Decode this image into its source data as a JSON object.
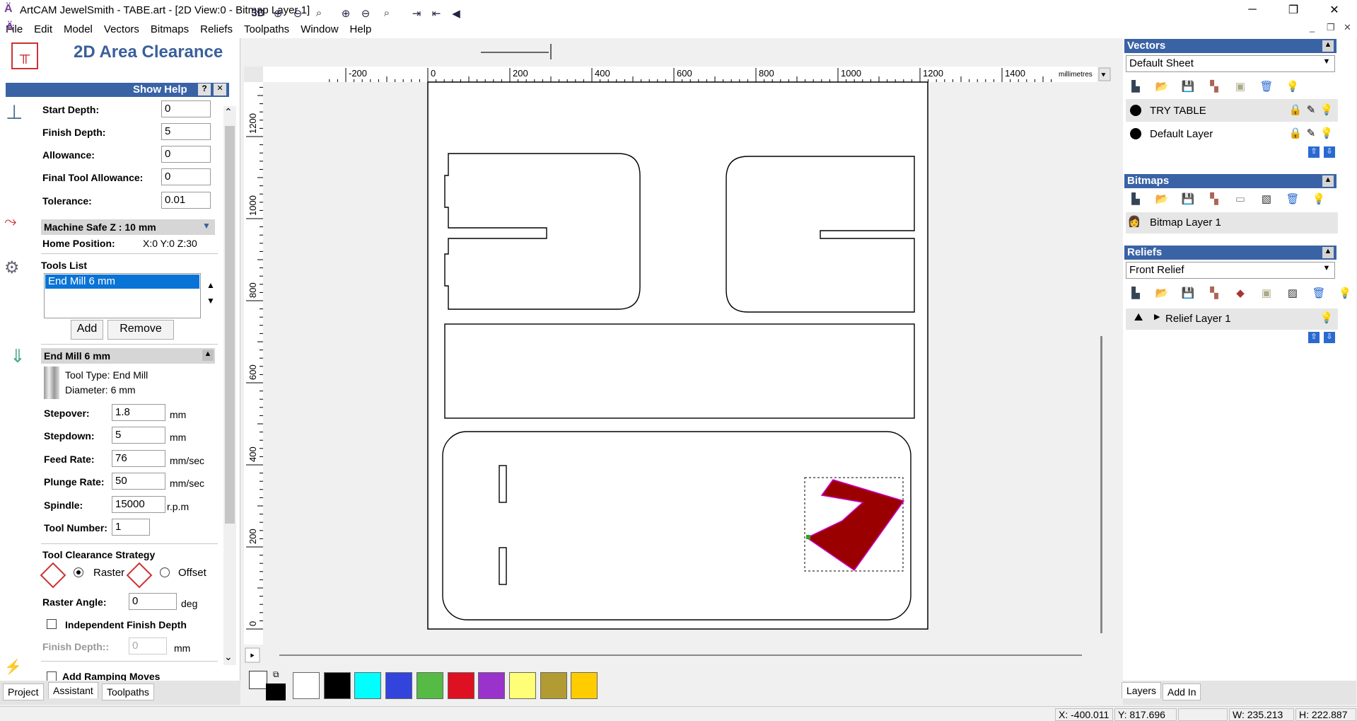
{
  "window": {
    "title": "ArtCAM JewelSmith - TABE.art - [2D View:0 - Bitmap Layer 1]"
  },
  "menu": [
    "File",
    "Edit",
    "Model",
    "Vectors",
    "Bitmaps",
    "Reliefs",
    "Toolpaths",
    "Window",
    "Help"
  ],
  "panel": {
    "title": "2D Area Clearance",
    "show_help": "Show Help",
    "help_btn": "?",
    "close_btn": "✕",
    "fields": [
      {
        "label": "Start Depth:",
        "value": "0"
      },
      {
        "label": "Finish Depth:",
        "value": "5"
      },
      {
        "label": "Allowance:",
        "value": "0"
      },
      {
        "label": "Final Tool Allowance:",
        "value": "0"
      },
      {
        "label": "Tolerance:",
        "value": "0.01"
      }
    ],
    "machine_safe_z": "Machine Safe Z : 10 mm",
    "home_position_label": "Home Position:",
    "home_position_value": "X:0 Y:0 Z:30",
    "tools_list_label": "Tools List",
    "tools_list_item": "End Mill 6 mm",
    "add": "Add",
    "remove": "Remove",
    "tool_header": "End Mill 6 mm",
    "tool_type": "Tool Type: End Mill",
    "diameter": "Diameter: 6 mm",
    "tool_fields": [
      {
        "label": "Stepover:",
        "value": "1.8",
        "unit": "mm"
      },
      {
        "label": "Stepdown:",
        "value": "5",
        "unit": "mm"
      },
      {
        "label": "Feed Rate:",
        "value": "76",
        "unit": "mm/sec"
      },
      {
        "label": "Plunge Rate:",
        "value": "50",
        "unit": "mm/sec"
      },
      {
        "label": "Spindle:",
        "value": "15000",
        "unit": "r.p.m"
      },
      {
        "label": "Tool Number:",
        "value": "1",
        "unit": ""
      }
    ],
    "strategy_label": "Tool Clearance Strategy",
    "raster": "Raster",
    "offset": "Offset",
    "raster_angle_label": "Raster Angle:",
    "raster_angle_value": "0",
    "deg": "deg",
    "independent_finish": "Independent Finish Depth",
    "finish_depth_label": "Finish Depth::",
    "finish_depth_value": "0",
    "mm": "mm",
    "add_ramping": "Add Ramping Moves",
    "tabs": [
      "Project",
      "Assistant",
      "Toolpaths"
    ]
  },
  "toolbar": {
    "label_3d": "3D",
    "units": "millimetres"
  },
  "ruler": {
    "x_ticks": [
      "-200",
      "0",
      "200",
      "400",
      "600",
      "800",
      "1000",
      "1200",
      "1400"
    ],
    "y_ticks": [
      "1200",
      "1000",
      "800",
      "600",
      "400",
      "200",
      "0"
    ]
  },
  "palette": [
    "#ffffff",
    "#000000",
    "#00ffff",
    "#3344dd",
    "#55bb44",
    "#dd1122",
    "#9933cc",
    "#ffff77",
    "#b39b33",
    "#ffcc00"
  ],
  "right": {
    "vectors_title": "Vectors",
    "vectors_sheet": "Default Sheet",
    "vector_layers": [
      "TRY TABLE",
      "Default Layer"
    ],
    "bitmaps_title": "Bitmaps",
    "bitmap_layer": "Bitmap Layer 1",
    "reliefs_title": "Reliefs",
    "reliefs_sheet": "Front Relief",
    "relief_layer": "Relief Layer 1",
    "tabs": [
      "Layers",
      "Add In"
    ]
  },
  "status": {
    "x": "X: -400.011",
    "y": "Y: 817.696",
    "w": "W: 235.213",
    "h": "H: 222.887"
  }
}
